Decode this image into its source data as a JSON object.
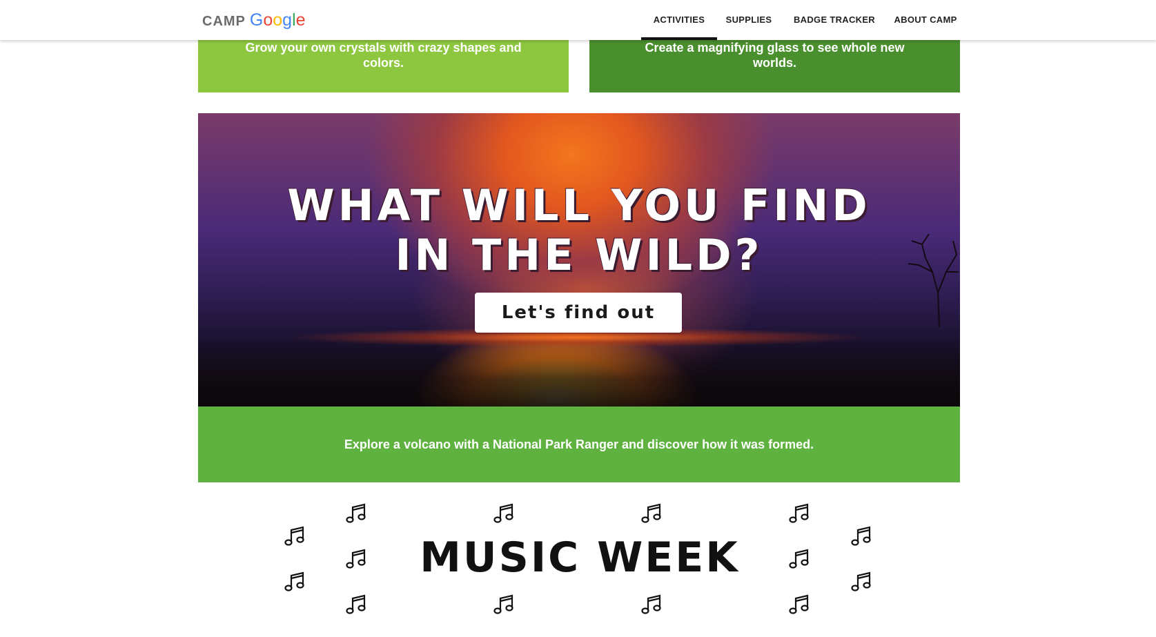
{
  "header": {
    "logo_camp": "CAMP",
    "logo_google_letters": [
      "G",
      "o",
      "o",
      "g",
      "l",
      "e"
    ],
    "logo_google_colors": [
      "#4285F4",
      "#EA4335",
      "#FBBC05",
      "#4285F4",
      "#34A853",
      "#EA4335"
    ],
    "nav": [
      {
        "label": "ACTIVITIES",
        "active": true
      },
      {
        "label": "SUPPLIES",
        "active": false
      },
      {
        "label": "BADGE TRACKER",
        "active": false
      },
      {
        "label": "ABOUT CAMP",
        "active": false
      }
    ]
  },
  "cards": {
    "left_text": "Grow your own crystals with crazy shapes and colors.",
    "right_text": "Create a magnifying glass to see whole new worlds.",
    "left_color": "#8dc63f",
    "right_color": "#4a8f2e"
  },
  "hero": {
    "title_line1": "What will you find",
    "title_line2": "in the wild?",
    "cta_label": "Let's find out",
    "caption": "Explore a volcano with a National Park Ranger and discover how it was formed.",
    "caption_color": "#5fb23f"
  },
  "music": {
    "title": "Music Week",
    "icon": "music-note-icon"
  }
}
